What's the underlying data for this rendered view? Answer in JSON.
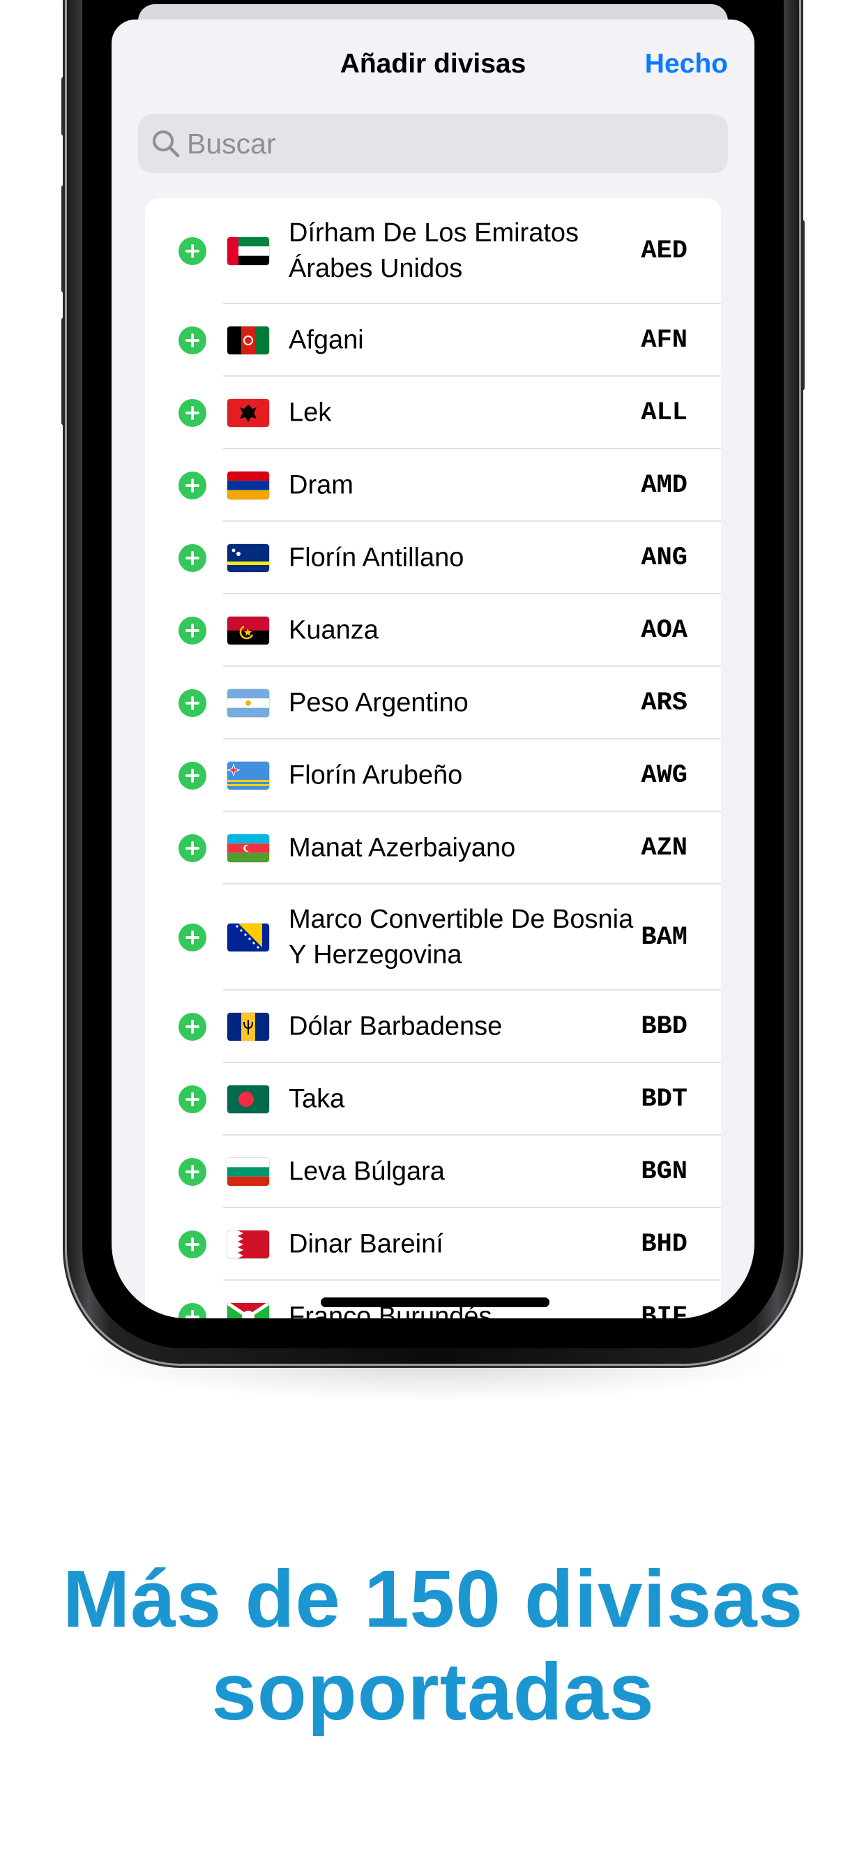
{
  "sheet": {
    "title": "Añadir divisas",
    "done_label": "Hecho"
  },
  "search": {
    "placeholder": "Buscar",
    "value": ""
  },
  "currencies": [
    {
      "name": "Dírham De Los Emiratos Árabes Unidos",
      "code": "AED",
      "flag": "flag-uae"
    },
    {
      "name": "Afgani",
      "code": "AFN",
      "flag": "flag-afghanistan"
    },
    {
      "name": "Lek",
      "code": "ALL",
      "flag": "flag-albania"
    },
    {
      "name": "Dram",
      "code": "AMD",
      "flag": "flag-armenia"
    },
    {
      "name": "Florín Antillano",
      "code": "ANG",
      "flag": "flag-curacao"
    },
    {
      "name": "Kuanza",
      "code": "AOA",
      "flag": "flag-angola"
    },
    {
      "name": "Peso Argentino",
      "code": "ARS",
      "flag": "flag-argentina"
    },
    {
      "name": "Florín Arubeño",
      "code": "AWG",
      "flag": "flag-aruba"
    },
    {
      "name": "Manat Azerbaiyano",
      "code": "AZN",
      "flag": "flag-azerbaijan"
    },
    {
      "name": "Marco Convertible De Bosnia Y Herzegovina",
      "code": "BAM",
      "flag": "flag-bosnia"
    },
    {
      "name": "Dólar Barbadense",
      "code": "BBD",
      "flag": "flag-barbados"
    },
    {
      "name": "Taka",
      "code": "BDT",
      "flag": "flag-bangladesh"
    },
    {
      "name": "Leva Búlgara",
      "code": "BGN",
      "flag": "flag-bulgaria"
    },
    {
      "name": "Dinar Bareiní",
      "code": "BHD",
      "flag": "flag-bahrain"
    },
    {
      "name": "Franco Burundés",
      "code": "BIF",
      "flag": "flag-burundi"
    }
  ],
  "headline": {
    "line1": "Más de 150 divisas",
    "line2": "soportadas"
  },
  "colors": {
    "accent": "#0a7aff",
    "add": "#34c759",
    "headline": "#1c96d1",
    "sheet_bg": "#f2f2f7"
  }
}
